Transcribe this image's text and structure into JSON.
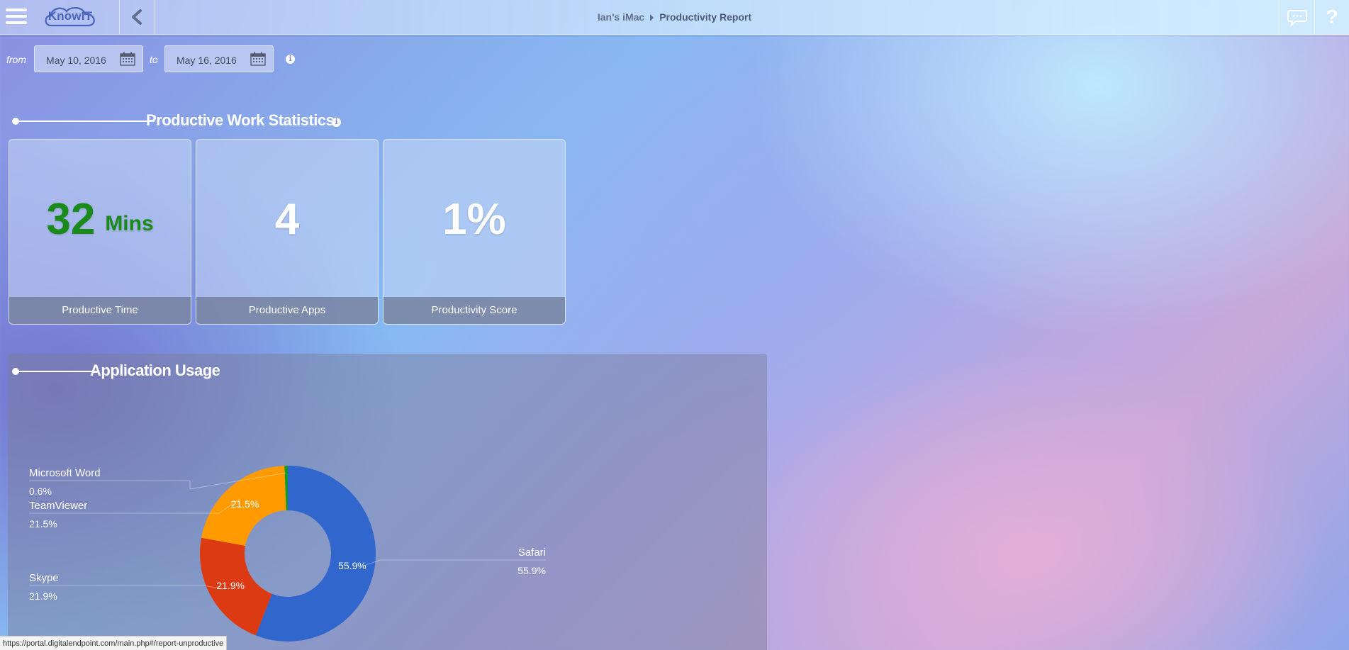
{
  "header": {
    "device": "Ian's iMac",
    "page": "Productivity Report",
    "logo_text": "KnowIT"
  },
  "filter": {
    "from_label": "from",
    "from_date": "May 10, 2016",
    "to_label": "to",
    "to_date": "May 16, 2016"
  },
  "stats": {
    "heading": "Productive Work Statistics",
    "cards": [
      {
        "value": "32",
        "unit": "Mins",
        "label": "Productive Time"
      },
      {
        "value": "4",
        "label": "Productive Apps"
      },
      {
        "value": "1%",
        "label": "Productivity Score"
      }
    ]
  },
  "usage": {
    "heading": "Application Usage"
  },
  "chart_data": {
    "type": "pie",
    "donut": true,
    "slices": [
      {
        "name": "Safari",
        "value": 55.9,
        "label": "55.9%",
        "color": "#3167cc"
      },
      {
        "name": "Skype",
        "value": 21.9,
        "label": "21.9%",
        "color": "#dc3a12"
      },
      {
        "name": "TeamViewer",
        "value": 21.5,
        "label": "21.5%",
        "color": "#ff9a00"
      },
      {
        "name": "Microsoft Word",
        "value": 0.6,
        "label": "0.6%",
        "color": "#119a26"
      }
    ]
  },
  "statusbar": {
    "url": "https://portal.digitalendpoint.com/main.php#/report-unproductive"
  },
  "colors": {
    "productive_time": "#1a8a1a",
    "card_footer": "#6e7896"
  }
}
